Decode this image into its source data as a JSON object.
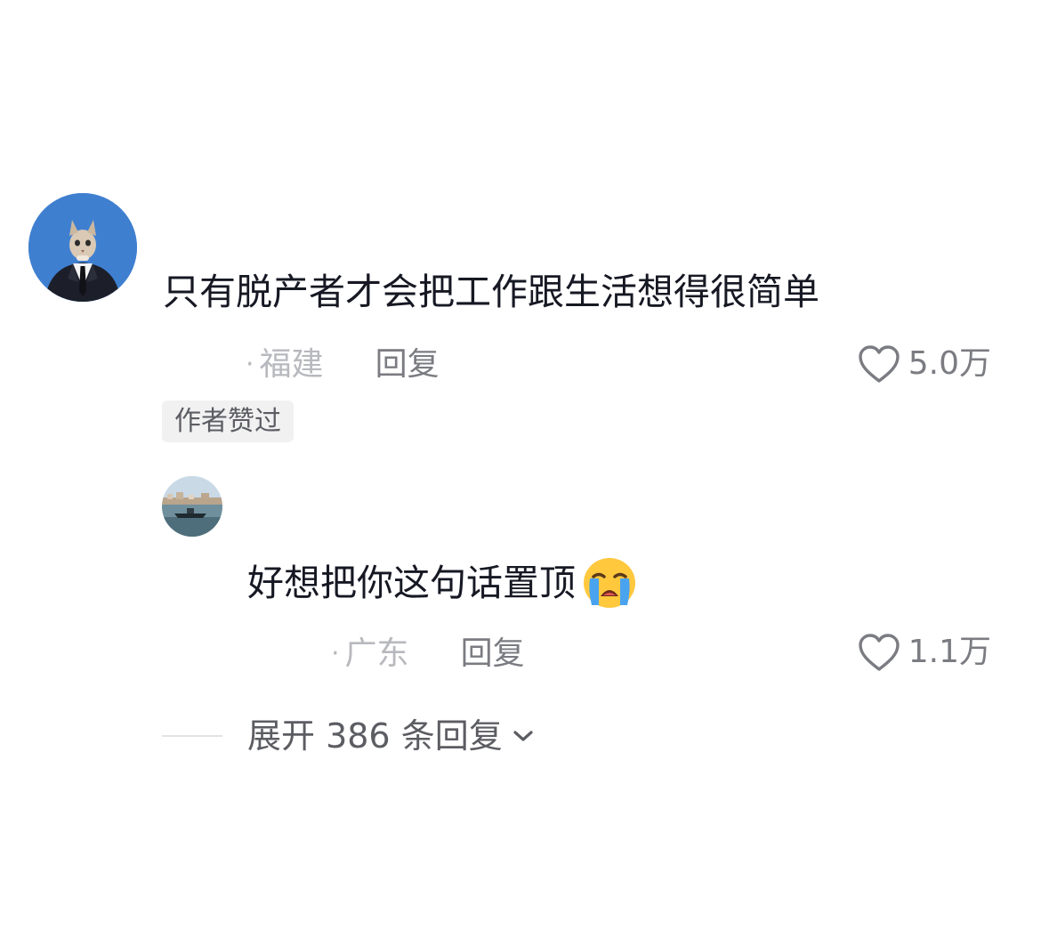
{
  "main_comment": {
    "avatar_icon": "cat-in-suit-avatar",
    "text": "只有脱产者才会把工作跟生活想得很简单",
    "location": "福建",
    "reply_label": "回复",
    "like_count": "5.0万",
    "like_icon": "heart-outline-icon",
    "author_badge": "作者赞过"
  },
  "reply_comment": {
    "avatar_icon": "harbor-boat-avatar",
    "text": "好想把你这句话置顶",
    "emoji": "crying-face-emoji",
    "location": "广东",
    "reply_label": "回复",
    "like_count": "1.1万",
    "like_icon": "heart-outline-icon"
  },
  "expand": {
    "label": "展开 386 条回复",
    "icon": "chevron-down-icon"
  },
  "colors": {
    "text_primary": "#161823",
    "text_secondary": "#7b7c82",
    "text_muted": "#b8b9be",
    "badge_bg": "#f1f1f2",
    "avatar_blue": "#3f7fd0"
  }
}
